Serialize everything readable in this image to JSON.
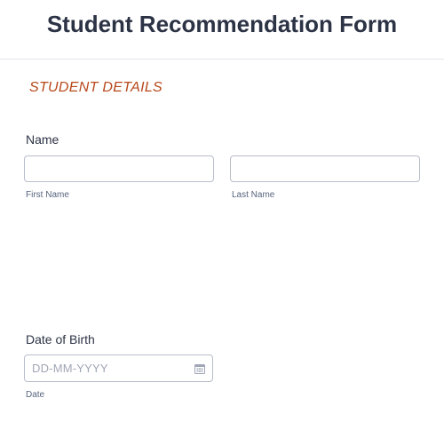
{
  "form": {
    "title": "Student Recommendation Form"
  },
  "section": {
    "title": "STUDENT DETAILS"
  },
  "name_field": {
    "label": "Name",
    "first_sublabel": "First Name",
    "last_sublabel": "Last Name",
    "first_value": "",
    "last_value": ""
  },
  "dob_field": {
    "label": "Date of Birth",
    "placeholder": "DD-MM-YYYY",
    "sublabel": "Date",
    "icon": "calendar-icon"
  },
  "colors": {
    "section_accent": "#b7481b",
    "text": "#2c3345",
    "border": "#b8bdc9"
  }
}
